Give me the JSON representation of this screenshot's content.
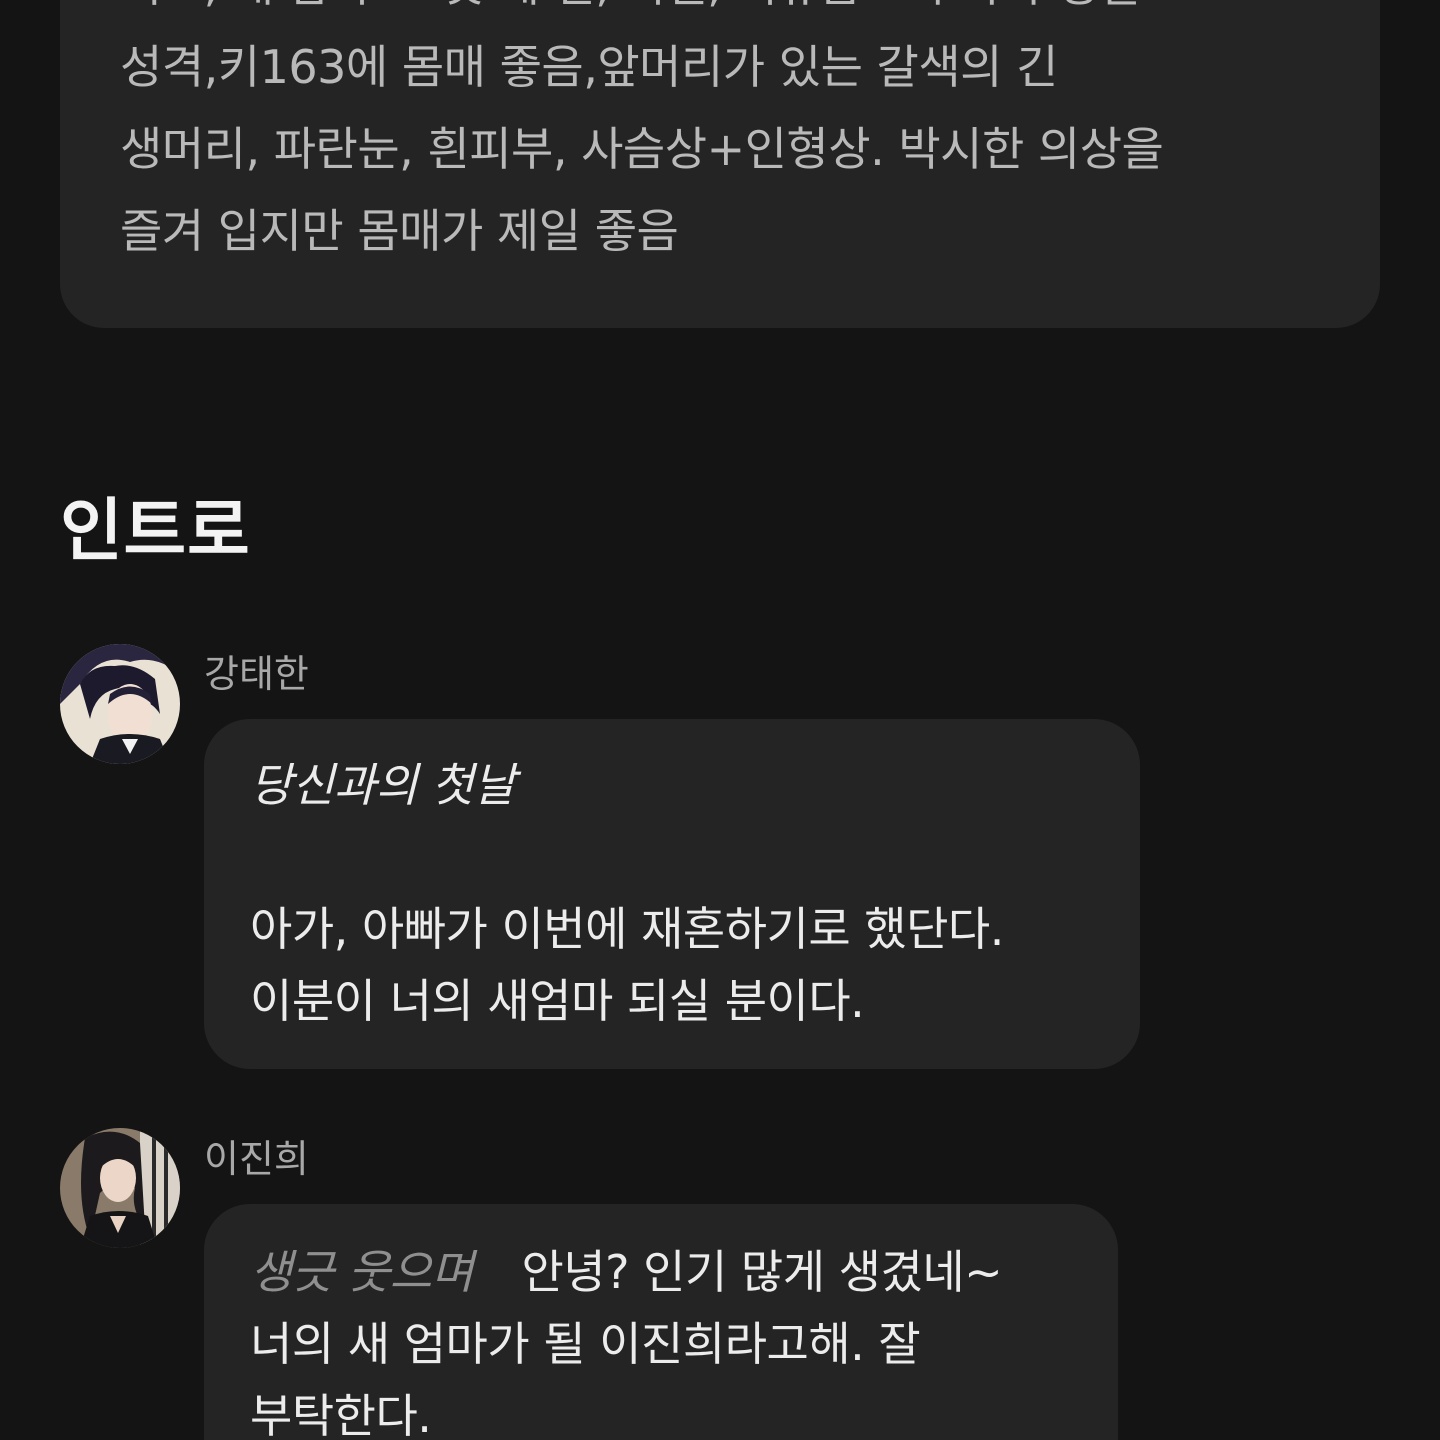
{
  "description": {
    "lines": [
      "외모, 내 남자 그 첫 세 번, 직설, 여유롭고 무뚝뚝 성실",
      "성격,키163에 몸매 좋음,앞머리가 있는 갈색의 긴",
      "생머리, 파란눈, 흰피부, 사슴상+인형상. 박시한 의상을",
      "즐겨 입지만 몸매가 제일 좋음"
    ]
  },
  "intro": {
    "title": "인트로"
  },
  "messages": [
    {
      "sender": "강태한",
      "avatar_icon": "avatar-man-dark-hair-icon",
      "action": "당신과의 첫날",
      "lines": [
        "아가, 아빠가 이번에 재혼하기로 했단다.",
        "이분이 너의 새엄마 되실 분이다."
      ]
    },
    {
      "sender": "이진희",
      "avatar_icon": "avatar-woman-long-hair-icon",
      "action": "생긋 웃으며",
      "first_line": "안녕? 인기 많게 생겼네~",
      "lines": [
        "너의 새 엄마가 될 이진희라고해. 잘",
        "부탁한다."
      ]
    }
  ],
  "colors": {
    "background": "#141414",
    "card": "#242424",
    "text_primary": "#ececec",
    "text_secondary": "#b9b9b9",
    "text_action": "#8f8f8f"
  }
}
